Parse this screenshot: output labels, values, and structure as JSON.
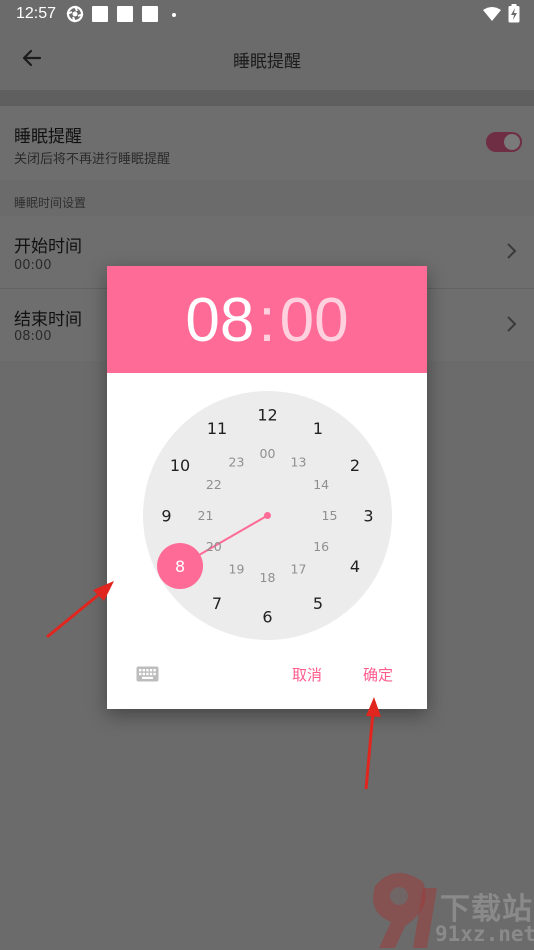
{
  "status_bar": {
    "time": "12:57",
    "icons": [
      "settings-app-icon",
      "notification-square-icon",
      "notification-square-icon",
      "notification-square-icon",
      "more-dot-icon",
      "wifi-icon",
      "battery-charging-icon"
    ]
  },
  "app_bar": {
    "title": "睡眠提醒",
    "back_icon": "back-arrow-icon"
  },
  "reminder_row": {
    "title": "睡眠提醒",
    "subtitle": "关闭后将不再进行睡眠提醒",
    "toggle_on": true
  },
  "section_label": "睡眠时间设置",
  "start_row": {
    "title": "开始时间",
    "value": "00:00"
  },
  "end_row": {
    "title": "结束时间",
    "value": "08:00"
  },
  "dialog": {
    "hour": "08",
    "separator": ":",
    "minute": "00",
    "selected_hour": 8,
    "outer_hours": [
      "12",
      "1",
      "2",
      "3",
      "4",
      "5",
      "6",
      "7",
      "8",
      "9",
      "10",
      "11"
    ],
    "inner_hours": [
      "00",
      "13",
      "14",
      "15",
      "16",
      "17",
      "18",
      "19",
      "20",
      "21",
      "22",
      "23"
    ],
    "keyboard_icon": "keyboard-icon",
    "cancel_label": "取消",
    "ok_label": "确定"
  },
  "watermark": {
    "line1": "下载站",
    "line2": "91xz.net"
  },
  "colors": {
    "accent": "#ff6b97",
    "button_text": "#ff5c8c",
    "dial_bg": "#ececec"
  }
}
